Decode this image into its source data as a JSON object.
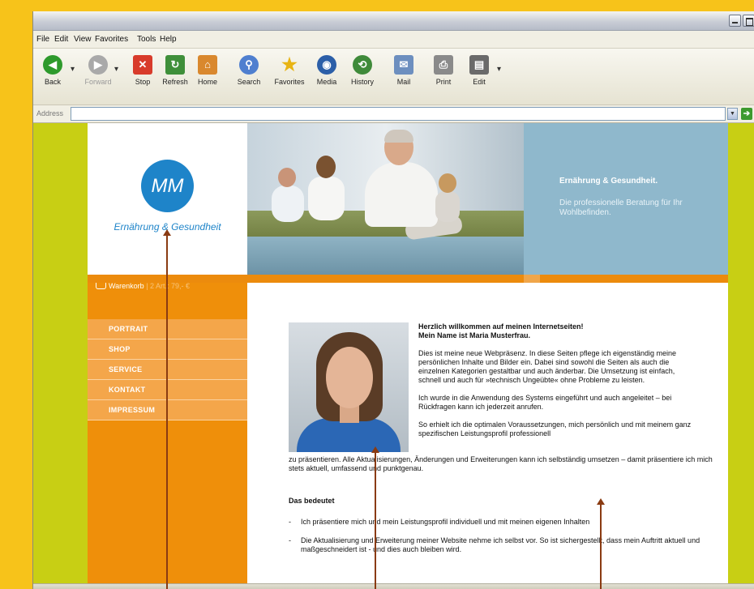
{
  "menu": [
    "File",
    "Edit",
    "View",
    "Favorites",
    "Tools",
    "Help"
  ],
  "toolbar": {
    "back": "Back",
    "forward": "Forward",
    "stop": "Stop",
    "refresh": "Refresh",
    "home": "Home",
    "search": "Search",
    "favorites": "Favorites",
    "media": "Media",
    "history": "History",
    "mail": "Mail",
    "print": "Print",
    "edit": "Edit"
  },
  "address": {
    "label": "Address",
    "value": ""
  },
  "site": {
    "logo_initials": "MM",
    "logo_tagline": "Ernährung & Gesundheit",
    "header_title": "Ernährung & Gesundheit.",
    "header_text": "Die professionelle Beratung für Ihr Wohlbefinden.",
    "cart": {
      "label": "Warenkorb",
      "info": " | 2 Art.: 79,- €"
    },
    "nav": [
      "PORTRAIT",
      "SHOP",
      "SERVICE",
      "KONTAKT",
      "IMPRESSUM"
    ],
    "welcome_line1": "Herzlich willkommen auf meinen Internetseiten!",
    "welcome_line2": "Mein Name ist Maria Musterfrau.",
    "para1": "Dies ist meine neue Webpräsenz. In diese Seiten pflege ich eigenständig meine persönlichen Inhalte und Bilder ein. Dabei sind sowohl die Seiten als auch die einzelnen Kategorien gestaltbar und auch änderbar. Die Umsetzung ist einfach, schnell und auch für »technisch Ungeübte« ohne Probleme zu leisten.",
    "para2": "Ich wurde in die Anwendung des Systems eingeführt und auch angeleitet – bei Rückfragen kann ich jederzeit anrufen.",
    "para3_start": "So erhielt ich die optimalen Voraussetzungen, mich persönlich und mit meinem ganz spezifischen Leistungsprofil professionell",
    "para3_end": "zu präsentieren. Alle Aktualisierungen, Änderungen und Erweiterungen kann ich selbständig umsetzen – damit präsentiere ich mich stets aktuell, umfassend und punktgenau.",
    "subheading": "Das bedeutet",
    "bullets": [
      "Ich präsentiere mich und mein Leistungsprofil individuell und mit meinen eigenen Inhalten",
      "Die Aktualisierung und Erweiterung meiner Website nehme ich selbst vor. So ist sichergestellt, dass mein Auftritt aktuell und maßgeschneidert ist - und dies auch bleiben wird."
    ]
  },
  "colors": {
    "page_bg": "#f7c31a",
    "site_side": "#c8cf14",
    "orange": "#ef8f0a",
    "nav_item": "#f4a64a",
    "header_blue": "#8fb8cc",
    "logo_blue": "#1e84c9",
    "arrow": "#8a3b12"
  }
}
